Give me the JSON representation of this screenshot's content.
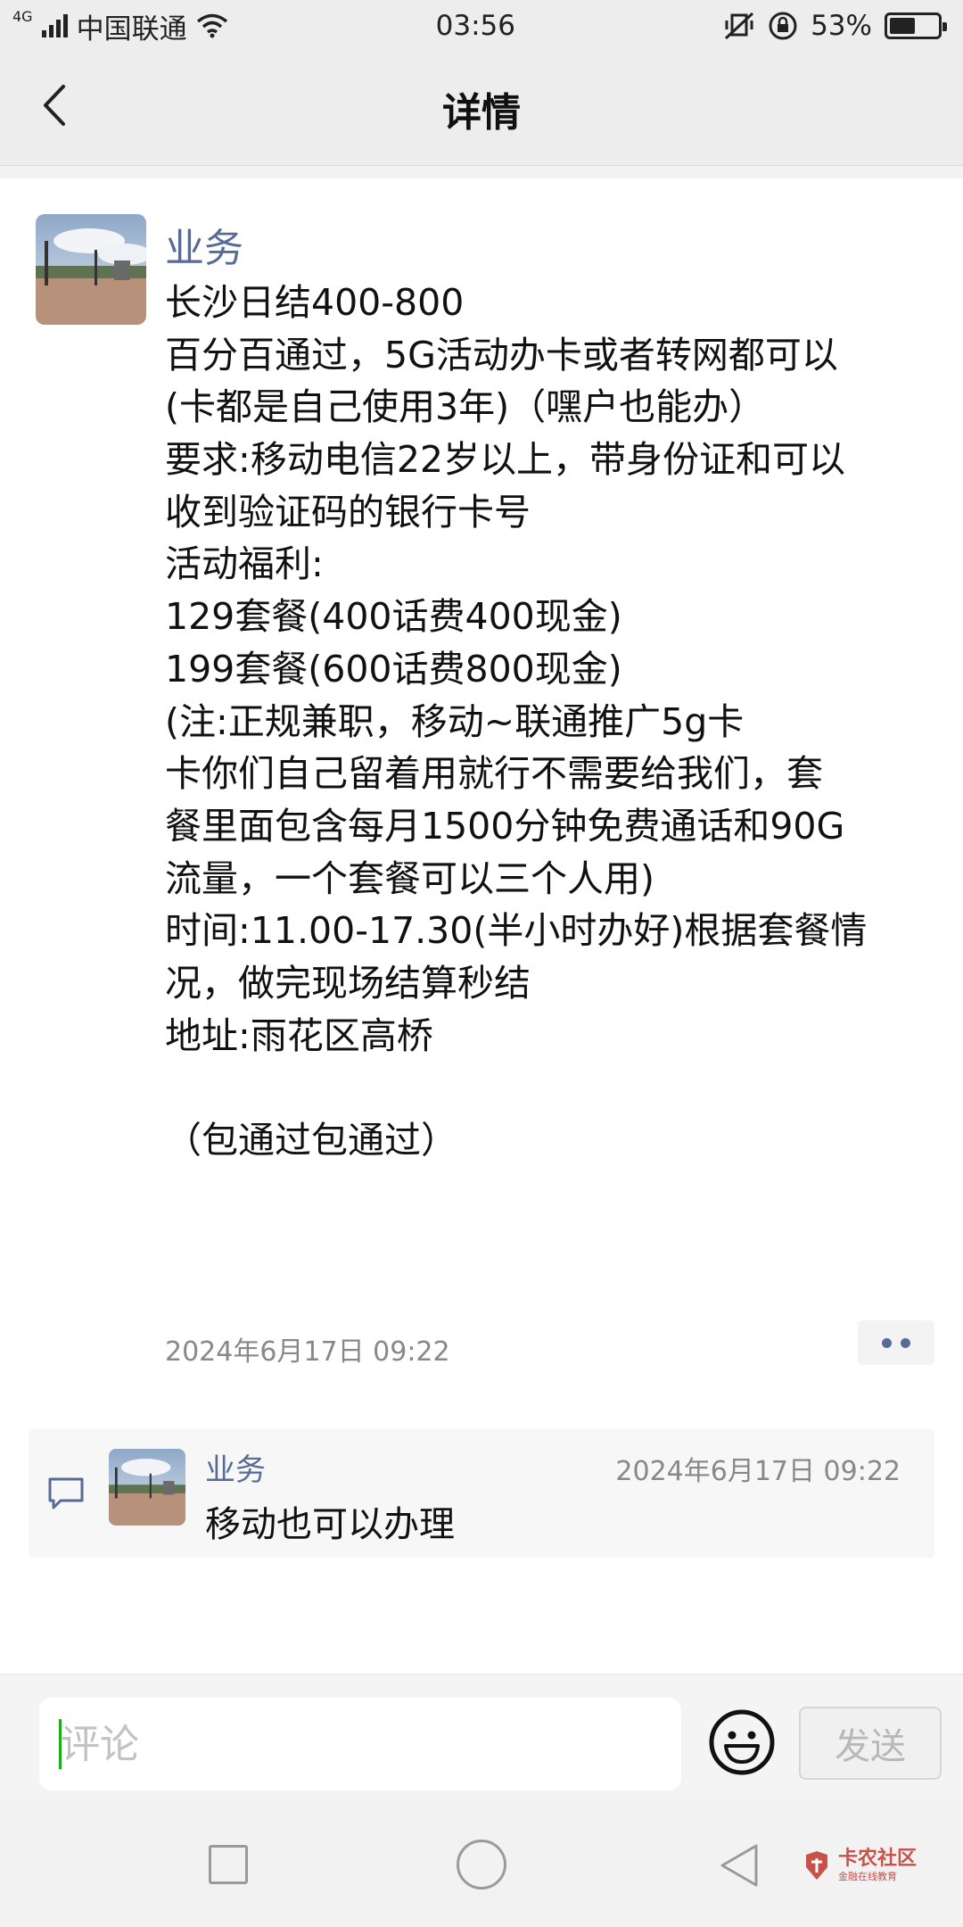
{
  "status_bar": {
    "network": "4G",
    "carrier": "中国联通",
    "time": "03:56",
    "battery": "53%",
    "battery_level": 0.53
  },
  "header": {
    "title": "详情"
  },
  "post": {
    "author": "业务",
    "lines": [
      "长沙日结400-800",
      "百分百通过，5G活动办卡或者转网都可以",
      "(卡都是自己使用3年)（嘿户也能办）",
      "要求:移动电信22岁以上，带身份证和可以",
      "收到验证码的银行卡号",
      "活动福利:",
      "129套餐(400话费400现金)",
      "199套餐(600话费800现金)",
      "(注:正规兼职，移动~联通推广5g卡",
      "卡你们自己留着用就行不需要给我们，套",
      "餐里面包含每月1500分钟免费通话和90G",
      "流量，一个套餐可以三个人用)",
      "时间:11.00-17.30(半小时办好)根据套餐情",
      "况，做完现场结算秒结",
      "地址:雨花区高桥",
      "",
      "（包通过包通过）"
    ],
    "timestamp": "2024年6月17日 09:22"
  },
  "comment": {
    "author": "业务",
    "timestamp": "2024年6月17日 09:22",
    "text": "移动也可以办理"
  },
  "input_bar": {
    "placeholder": "评论",
    "send_label": "发送"
  },
  "watermark": {
    "main": "卡农社区",
    "sub": "金融在线教育"
  },
  "colors": {
    "link_name": "#576b95",
    "caret": "#1aad19",
    "watermark": "#c8514a"
  }
}
